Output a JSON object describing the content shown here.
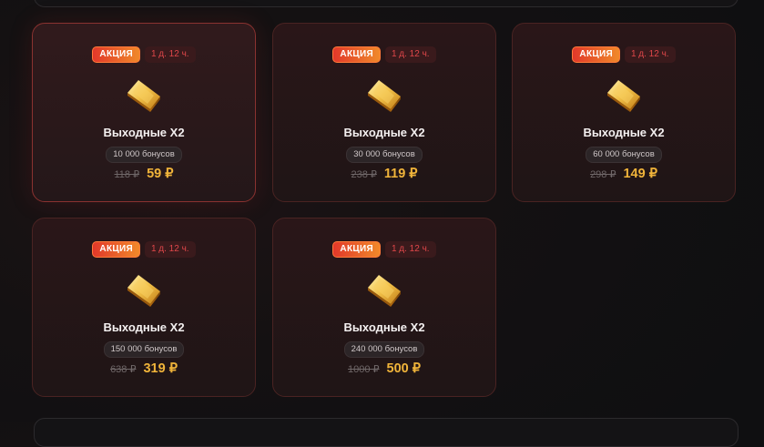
{
  "colors": {
    "accent_gold": "#f0b43a",
    "promo_start": "#e2382a",
    "promo_end": "#f0892a",
    "timer_text": "#e0474a",
    "card_border": "#4a2322"
  },
  "offers": [
    {
      "promo_label": "АКЦИЯ",
      "timer": "1 д. 12 ч.",
      "icon": "gold-bar-icon",
      "title": "Выходные X2",
      "bonus": "10 000 бонусов",
      "old_price": "118 ₽",
      "new_price": "59 ₽",
      "highlighted": true
    },
    {
      "promo_label": "АКЦИЯ",
      "timer": "1 д. 12 ч.",
      "icon": "gold-bar-icon",
      "title": "Выходные X2",
      "bonus": "30 000 бонусов",
      "old_price": "238 ₽",
      "new_price": "119 ₽",
      "highlighted": false
    },
    {
      "promo_label": "АКЦИЯ",
      "timer": "1 д. 12 ч.",
      "icon": "gold-bar-icon",
      "title": "Выходные X2",
      "bonus": "60 000 бонусов",
      "old_price": "298 ₽",
      "new_price": "149 ₽",
      "highlighted": false
    },
    {
      "promo_label": "АКЦИЯ",
      "timer": "1 д. 12 ч.",
      "icon": "gold-bar-icon",
      "title": "Выходные X2",
      "bonus": "150 000 бонусов",
      "old_price": "638 ₽",
      "new_price": "319 ₽",
      "highlighted": false
    },
    {
      "promo_label": "АКЦИЯ",
      "timer": "1 д. 12 ч.",
      "icon": "gold-bar-icon",
      "title": "Выходные X2",
      "bonus": "240 000 бонусов",
      "old_price": "1000 ₽",
      "new_price": "500 ₽",
      "highlighted": false
    }
  ]
}
